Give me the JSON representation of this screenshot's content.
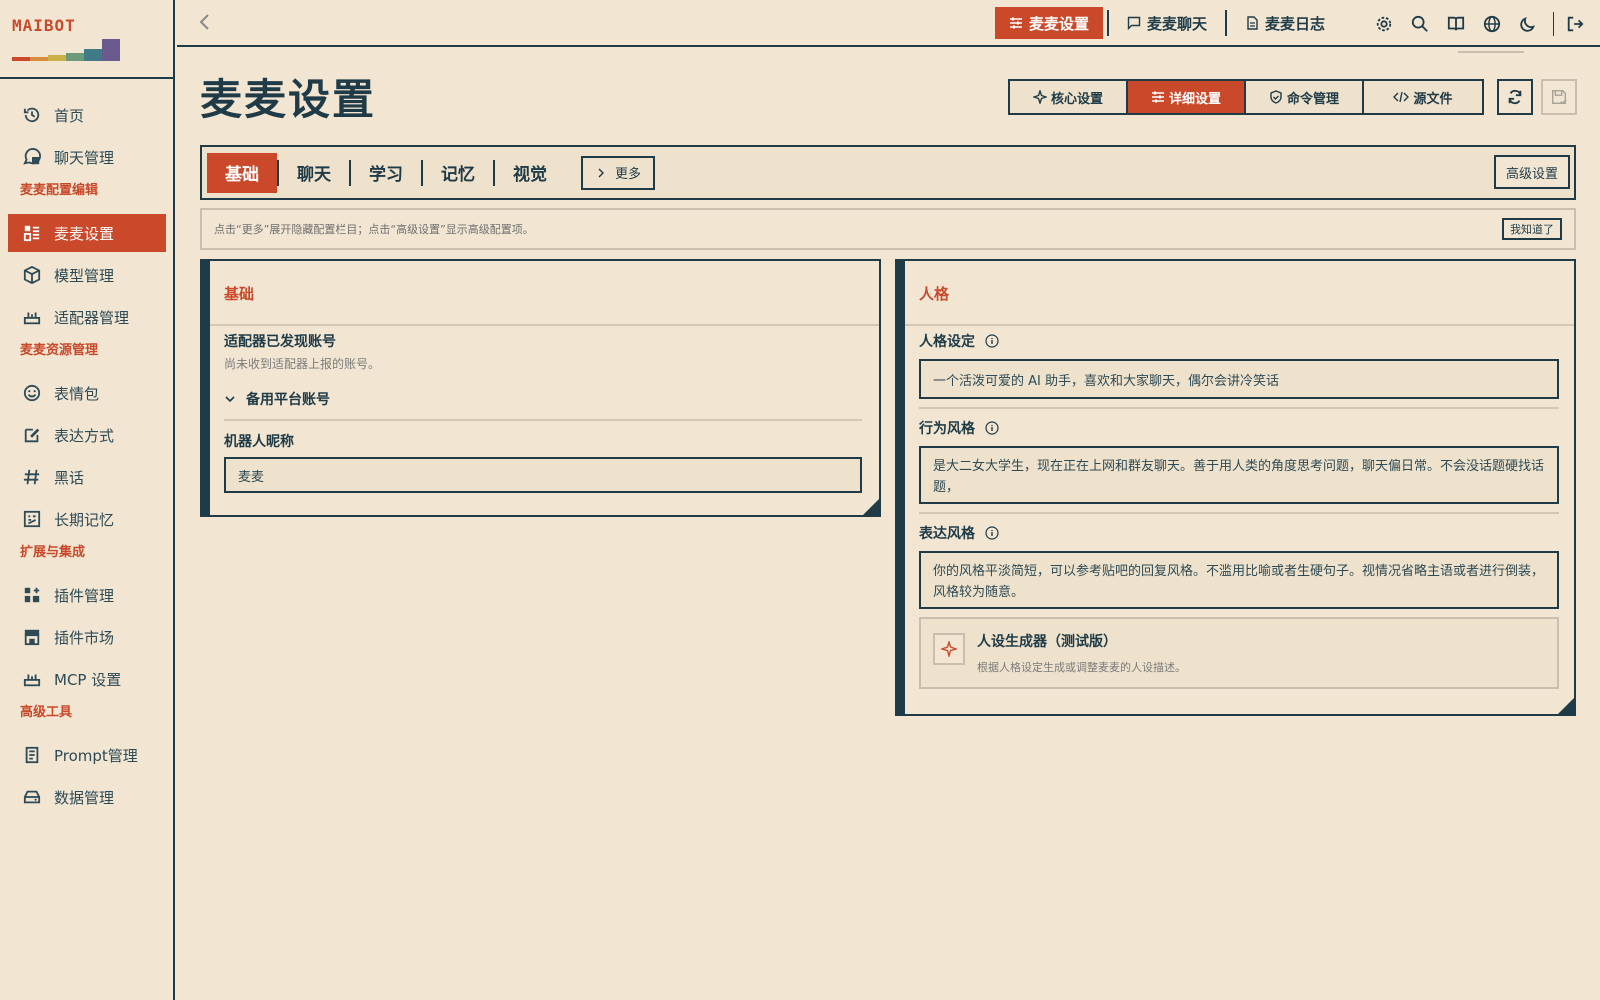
{
  "app": {
    "logo": "MAIBOT"
  },
  "sidebar": {
    "items": [
      {
        "label": "首页",
        "icon": "home-icon"
      },
      {
        "label": "聊天管理",
        "icon": "chat-icon"
      }
    ],
    "sections": [
      {
        "title": "麦麦配置编辑",
        "items": [
          {
            "label": "麦麦设置",
            "icon": "settings-icon",
            "active": true
          },
          {
            "label": "模型管理",
            "icon": "cube-icon"
          },
          {
            "label": "适配器管理",
            "icon": "adapter-icon"
          }
        ]
      },
      {
        "title": "麦麦资源管理",
        "items": [
          {
            "label": "表情包",
            "icon": "smile-icon"
          },
          {
            "label": "表达方式",
            "icon": "edit-icon"
          },
          {
            "label": "黑话",
            "icon": "hash-icon"
          },
          {
            "label": "长期记忆",
            "icon": "memory-icon"
          }
        ]
      },
      {
        "title": "扩展与集成",
        "items": [
          {
            "label": "插件管理",
            "icon": "plugin-icon"
          },
          {
            "label": "插件市场",
            "icon": "store-icon"
          },
          {
            "label": "MCP 设置",
            "icon": "mcp-icon"
          }
        ]
      },
      {
        "title": "高级工具",
        "items": [
          {
            "label": "Prompt管理",
            "icon": "prompt-icon"
          },
          {
            "label": "数据管理",
            "icon": "database-icon"
          }
        ]
      }
    ]
  },
  "topbar": {
    "tabs": [
      {
        "label": "麦麦设置",
        "active": true
      },
      {
        "label": "麦麦聊天"
      },
      {
        "label": "麦麦日志"
      }
    ]
  },
  "main": {
    "title": "麦麦设置",
    "view_tabs": [
      {
        "label": "核心设置"
      },
      {
        "label": "详细设置",
        "active": true
      },
      {
        "label": "命令管理"
      },
      {
        "label": "源文件"
      }
    ],
    "section_tabs": [
      "基础",
      "聊天",
      "学习",
      "记忆",
      "视觉"
    ],
    "more_label": "更多",
    "advanced_label": "高级设置",
    "hint": {
      "text": "点击“更多”展开隐藏配置栏目；点击“高级设置”显示高级配置项。",
      "dismiss": "我知道了"
    },
    "basic_card": {
      "title": "基础",
      "adapter_label": "适配器已发现账号",
      "adapter_desc": "尚未收到适配器上报的账号。",
      "backup_label": "备用平台账号",
      "nickname_label": "机器人昵称",
      "nickname_value": "麦麦"
    },
    "persona_card": {
      "title": "人格",
      "personality_label": "人格设定",
      "personality_value": "一个活泼可爱的 AI 助手，喜欢和大家聊天，偶尔会讲冷笑话",
      "behavior_label": "行为风格",
      "behavior_value": "是大二女大学生，现在正在上网和群友聊天。善于用人类的角度思考问题，聊天偏日常。不会没话题硬找话题，",
      "expression_label": "表达风格",
      "expression_value": "你的风格平淡简短，可以参考贴吧的回复风格。不滥用比喻或者生硬句子。视情况省略主语或者进行倒装，风格较为随意。",
      "generator_title": "人设生成器（测试版）",
      "generator_desc": "根据人格设定生成或调整麦麦的人设描述。"
    }
  },
  "colors": {
    "accent": "#c9492a",
    "ink": "#1f3b47",
    "background": "#f2e6d3"
  }
}
